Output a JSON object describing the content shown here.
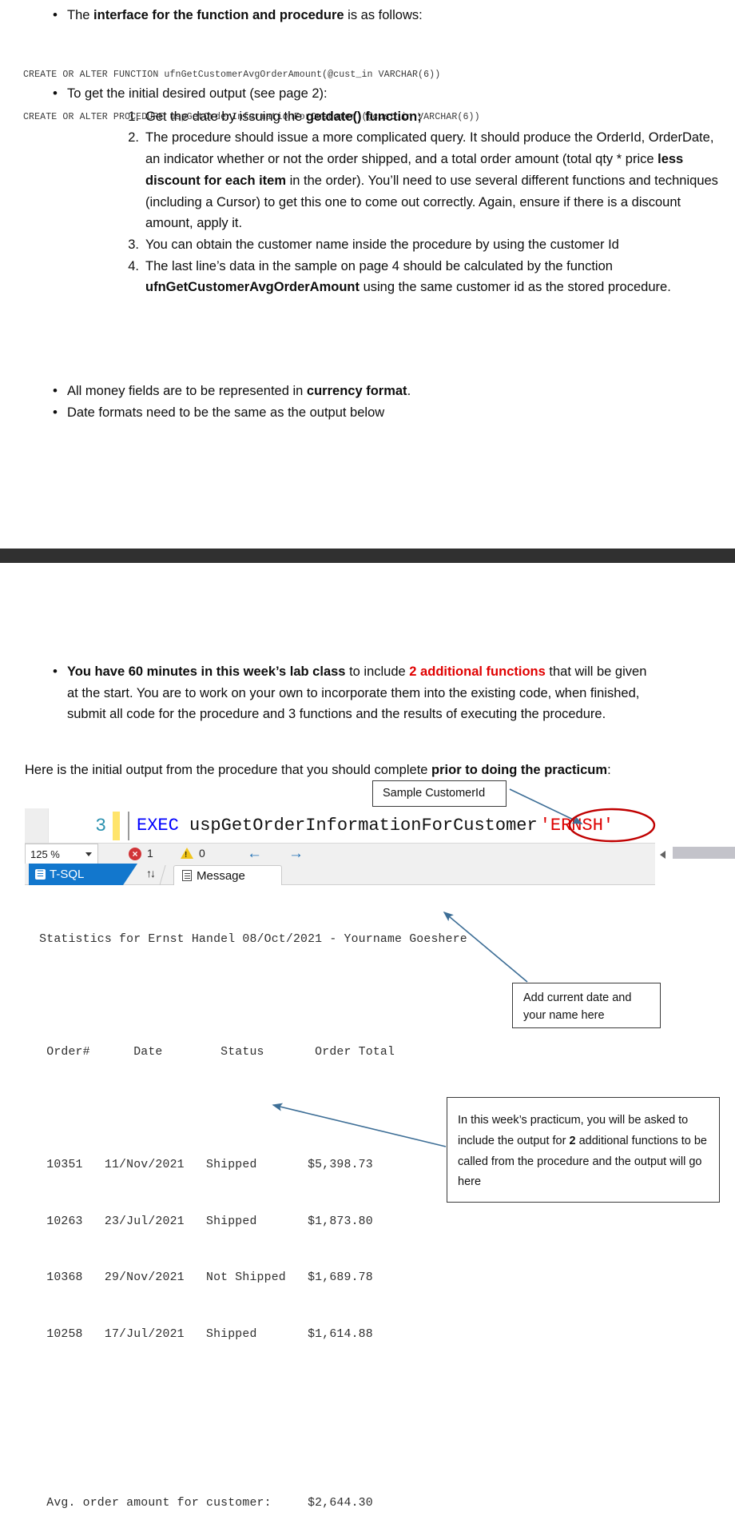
{
  "document": {
    "section1": {
      "bullet1": {
        "pre": "The ",
        "bold": "interface for the function and procedure",
        "post": " is as follows:"
      },
      "code_lines": [
        "CREATE OR ALTER FUNCTION ufnGetCustomerAvgOrderAmount(@cust_in VARCHAR(6))",
        "CREATE OR ALTER PROCEDURE uspGetOrderInformationForCustomer (@cust_in VARCHAR(6))"
      ],
      "bullet2": "To get the initial desired output (see page 2):",
      "numbered": [
        {
          "num": "1.",
          "pre": "Get the date by issuing the ",
          "bold": "getdate() function;",
          "post": ""
        },
        {
          "num": "2.",
          "pre": "The procedure should issue a more complicated query. It should produce the OrderId, OrderDate, an indicator whether or not the order shipped, and a total order amount (total qty * price ",
          "bold": "less discount for each item",
          "post": " in the order). You’ll need to use several different functions and techniques (including a Cursor) to get this one to come out correctly. Again, ensure if there is a discount amount, apply it."
        },
        {
          "num": "3.",
          "pre": "You can obtain the customer name inside the procedure by using the customer Id",
          "bold": "",
          "post": ""
        },
        {
          "num": "4.",
          "pre": "The last line’s data in the sample on page 4 should be calculated by the function ",
          "bold": "ufnGetCustomerAvgOrderAmount",
          "post": " using the same customer id as the stored procedure."
        }
      ],
      "bullet3": {
        "pre": "All money fields are to be represented in ",
        "bold": "currency format",
        "post": "."
      },
      "bullet4": "Date formats need to be the same as the output below"
    },
    "section2": {
      "bullet_practicum": {
        "bold1": "You have 60 minutes in this week’s lab class",
        "mid": " to include ",
        "red": "2 additional functions",
        "post": " that will be given at the start. You are to work on your own to incorporate them into the existing code, when finished, submit all code for the procedure and 3 functions and the results of executing the procedure."
      },
      "intro": {
        "pre": "Here is the initial output from the procedure that you should complete ",
        "bold": "prior to doing the practicum",
        "post": ":"
      }
    }
  },
  "editor": {
    "line_number": "3",
    "code_keyword": "EXEC",
    "code_identifier": " uspGetOrderInformationForCustomer",
    "code_string": "'ERNSH'",
    "zoom_level": "125 %",
    "error_count": "1",
    "warning_count": "0",
    "error_glyph": "×",
    "warning_glyph": "!",
    "back_arrow": "←",
    "forward_arrow": "→",
    "tabs": [
      {
        "label": "T-SQL",
        "icon": "tsql-icon",
        "selected": true
      },
      {
        "label": "Message",
        "icon": "message-icon",
        "selected": false
      }
    ],
    "sort_icon_glyph": "↑↓",
    "tsql_icon_glyph": "☰"
  },
  "console_output": {
    "header_line": "  Statistics for Ernst Handel 08/Oct/2021 - Yourname Goeshere",
    "blank1": "",
    "column_header": "   Order#      Date        Status       Order Total",
    "blank2": "",
    "rows": [
      "   10351   11/Nov/2021   Shipped       $5,398.73",
      "   10263   23/Jul/2021   Shipped       $1,873.80",
      "   10368   29/Nov/2021   Not Shipped   $1,689.78",
      "   10258   17/Jul/2021   Shipped       $1,614.88"
    ],
    "blank3": "",
    "footer_line": "   Avg. order amount for customer:     $2,644.30",
    "table": {
      "columns": [
        "Order#",
        "Date",
        "Status",
        "Order Total"
      ],
      "data": [
        [
          "10351",
          "11/Nov/2021",
          "Shipped",
          "$5,398.73"
        ],
        [
          "10263",
          "23/Jul/2021",
          "Shipped",
          "$1,873.80"
        ],
        [
          "10368",
          "29/Nov/2021",
          "Not Shipped",
          "$1,689.78"
        ],
        [
          "10258",
          "17/Jul/2021",
          "Shipped",
          "$1,614.88"
        ]
      ],
      "summary_label": "Avg. order amount for customer:",
      "summary_value": "$2,644.30"
    }
  },
  "callouts": {
    "sample_customer_id": "Sample CustomerId",
    "add_date": {
      "line1": "Add current date and",
      "line2": "your name here"
    },
    "practicum_note": {
      "pre": "In this week’s practicum, you will be asked to include the output for ",
      "bold": "2",
      "post": " additional functions to be called from the procedure and the output will go here"
    }
  },
  "colors": {
    "red_text": "#e00000",
    "annotation_arrow": "#3d6e96",
    "circle_highlight": "#c00000",
    "tab_selected": "#1277cd",
    "line_number": "#2b91af",
    "keyword_blue": "#0000ff",
    "change_bar": "#ffe46b",
    "dark_band": "#303030"
  }
}
